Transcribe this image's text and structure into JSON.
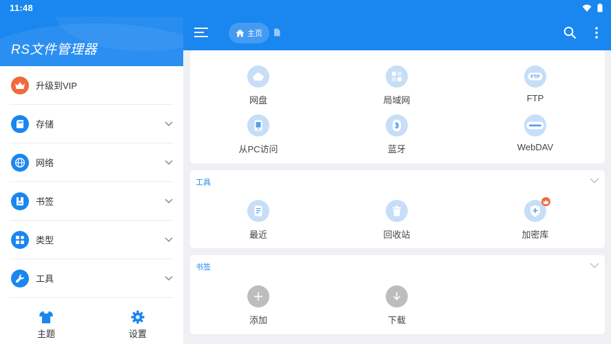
{
  "status_bar": {
    "time": "11:48",
    "icons": [
      "wifi-icon",
      "battery-icon"
    ]
  },
  "sidebar": {
    "app_title": "RS文件管理器",
    "items": [
      {
        "label": "升级到VIP",
        "icon": "crown-icon",
        "expandable": false
      },
      {
        "label": "存储",
        "icon": "sd-card-icon",
        "expandable": true
      },
      {
        "label": "网络",
        "icon": "globe-icon",
        "expandable": true
      },
      {
        "label": "书签",
        "icon": "bookmark-icon",
        "expandable": true
      },
      {
        "label": "类型",
        "icon": "category-icon",
        "expandable": true
      },
      {
        "label": "工具",
        "icon": "wrench-icon",
        "expandable": true
      }
    ],
    "footer": [
      {
        "label": "主题",
        "icon": "shirt-icon"
      },
      {
        "label": "设置",
        "icon": "gear-icon"
      }
    ]
  },
  "topbar": {
    "breadcrumb_home": "主页",
    "icons": [
      "menu-icon",
      "home-icon",
      "file-icon",
      "search-icon",
      "more-vert-icon"
    ]
  },
  "main": {
    "network_card": {
      "tiles": [
        {
          "label": "网盘",
          "icon": "cloud-drive-icon"
        },
        {
          "label": "局域网",
          "icon": "lan-icon"
        },
        {
          "label": "FTP",
          "icon": "ftp-icon"
        },
        {
          "label": "从PC访问",
          "icon": "pc-access-icon"
        },
        {
          "label": "蓝牙",
          "icon": "bluetooth-icon"
        },
        {
          "label": "WebDAV",
          "icon": "webdav-icon"
        }
      ]
    },
    "tools_card": {
      "title": "工具",
      "tiles": [
        {
          "label": "最近",
          "icon": "recent-icon"
        },
        {
          "label": "回收站",
          "icon": "recycle-bin-icon"
        },
        {
          "label": "加密库",
          "icon": "vault-icon",
          "badge": "crown-icon"
        }
      ]
    },
    "bookmarks_card": {
      "title": "书签",
      "tiles": [
        {
          "label": "添加",
          "icon": "add-icon"
        },
        {
          "label": "下载",
          "icon": "download-icon"
        }
      ]
    }
  },
  "colors": {
    "primary": "#1a86f0",
    "vip": "#f06a3a",
    "tile_bg": "#c6def8",
    "page_bg": "#eef0f3"
  }
}
